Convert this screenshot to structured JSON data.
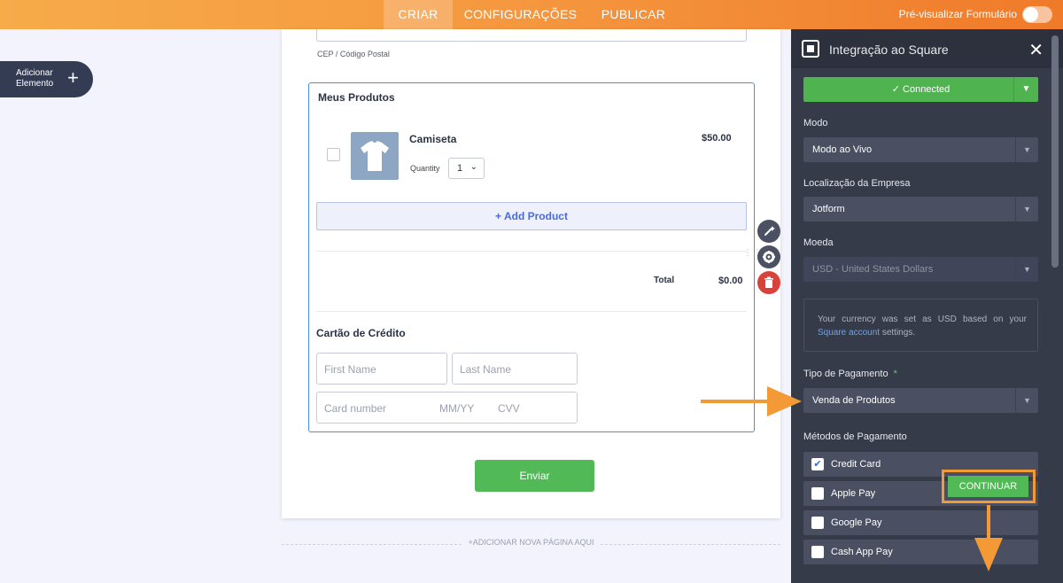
{
  "topbar": {
    "tabs": [
      {
        "label": "CRIAR",
        "active": true
      },
      {
        "label": "CONFIGURAÇÕES",
        "active": false
      },
      {
        "label": "PUBLICAR",
        "active": false
      }
    ],
    "preview_label": "Pré-visualizar Formulário"
  },
  "sidebar": {
    "add_element_label": "Adicionar\nElemento"
  },
  "form": {
    "cep_label": "CEP / Código Postal",
    "products_title": "Meus Produtos",
    "product": {
      "name": "Camiseta",
      "price": "$50.00",
      "quantity_label": "Quantity",
      "quantity_value": "1"
    },
    "add_product_label": "+ Add Product",
    "total_label": "Total",
    "total_value": "$0.00",
    "credit_card_title": "Cartão de Crédito",
    "first_name_placeholder": "First Name",
    "last_name_placeholder": "Last Name",
    "card_number_placeholder": "Card number",
    "expiry_placeholder": "MM/YY",
    "cvv_placeholder": "CVV",
    "submit_label": "Enviar",
    "new_page_label": "+ADICIONAR NOVA PÁGINA AQUI"
  },
  "panel": {
    "title": "Integração ao Square",
    "connected_label": "✓ Connected",
    "mode_label": "Modo",
    "mode_value": "Modo ao Vivo",
    "location_label": "Localização da Empresa",
    "location_value": "Jotform",
    "currency_label": "Moeda",
    "currency_value": "USD - United States Dollars",
    "currency_info_1": "Your currency was set as USD based on your ",
    "currency_info_link": "Square account",
    "currency_info_2": " settings.",
    "payment_type_label": "Tipo de Pagamento",
    "payment_type_required": "*",
    "payment_type_value": "Venda de Produtos",
    "payment_methods_label": "Métodos de Pagamento",
    "payment_methods": [
      {
        "label": "Credit Card",
        "checked": true
      },
      {
        "label": "Apple Pay",
        "checked": false
      },
      {
        "label": "Google Pay",
        "checked": false
      },
      {
        "label": "Cash App Pay",
        "checked": false
      }
    ],
    "continue_label": "CONTINUAR"
  },
  "colors": {
    "accent_orange": "#f39a36",
    "green": "#52b957",
    "panel_bg": "#363b49"
  }
}
